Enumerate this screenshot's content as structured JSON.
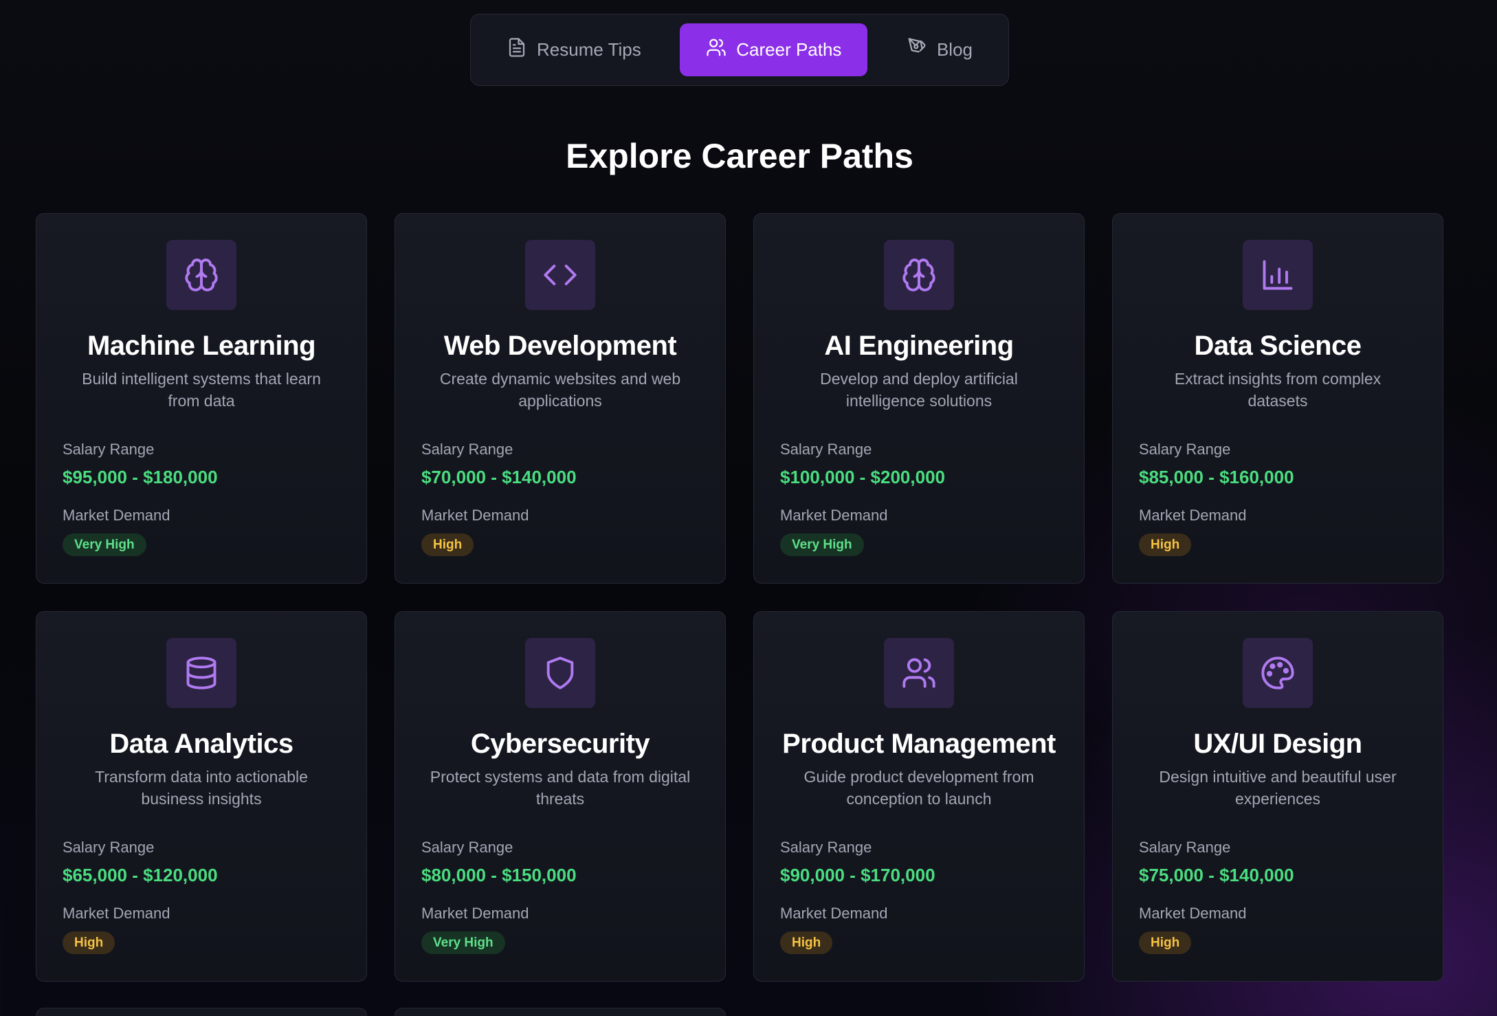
{
  "nav": {
    "tabs": [
      {
        "label": "Resume Tips",
        "icon": "document-icon",
        "active": false
      },
      {
        "label": "Career Paths",
        "icon": "users-icon",
        "active": true
      },
      {
        "label": "Blog",
        "icon": "pen-icon",
        "active": false
      }
    ]
  },
  "page": {
    "heading": "Explore Career Paths",
    "salary_label": "Salary Range",
    "demand_label": "Market Demand"
  },
  "colors": {
    "accent": "#8b30e8",
    "salary": "#4ade80",
    "very_high_badge": "#5ee08a",
    "high_badge": "#f6c344",
    "icon": "#b07af0"
  },
  "careers": [
    {
      "title": "Machine Learning",
      "description": "Build intelligent systems that learn from data",
      "salary": "$95,000 - $180,000",
      "demand": "Very High",
      "icon": "brain-icon"
    },
    {
      "title": "Web Development",
      "description": "Create dynamic websites and web applications",
      "salary": "$70,000 - $140,000",
      "demand": "High",
      "icon": "code-icon"
    },
    {
      "title": "AI Engineering",
      "description": "Develop and deploy artificial intelligence solutions",
      "salary": "$100,000 - $200,000",
      "demand": "Very High",
      "icon": "brain-icon"
    },
    {
      "title": "Data Science",
      "description": "Extract insights from complex datasets",
      "salary": "$85,000 - $160,000",
      "demand": "High",
      "icon": "bar-chart-icon"
    },
    {
      "title": "Data Analytics",
      "description": "Transform data into actionable business insights",
      "salary": "$65,000 - $120,000",
      "demand": "High",
      "icon": "database-icon"
    },
    {
      "title": "Cybersecurity",
      "description": "Protect systems and data from digital threats",
      "salary": "$80,000 - $150,000",
      "demand": "Very High",
      "icon": "shield-icon"
    },
    {
      "title": "Product Management",
      "description": "Guide product development from conception to launch",
      "salary": "$90,000 - $170,000",
      "demand": "High",
      "icon": "users-icon"
    },
    {
      "title": "UX/UI Design",
      "description": "Design intuitive and beautiful user experiences",
      "salary": "$75,000 - $140,000",
      "demand": "High",
      "icon": "palette-icon"
    }
  ]
}
